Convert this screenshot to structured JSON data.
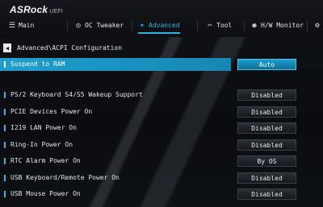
{
  "brand": {
    "name": "ASRock",
    "suffix": "UEFI"
  },
  "tabs": [
    {
      "label": "Main",
      "icon": "list-icon",
      "glyph": "☰"
    },
    {
      "label": "OC Tweaker",
      "icon": "gauge-icon",
      "glyph": "◎"
    },
    {
      "label": "Advanced",
      "icon": "star-icon",
      "glyph": "✶"
    },
    {
      "label": "Tool",
      "icon": "wrench-icon",
      "glyph": "✂"
    },
    {
      "label": "H/W Monitor",
      "icon": "monitor-icon",
      "glyph": "◉"
    },
    {
      "label": "",
      "icon": "gear-icon",
      "glyph": "⚙"
    }
  ],
  "active_tab": "Advanced",
  "breadcrumb": "Advanced\\ACPI Configuration",
  "settings": [
    {
      "label": "Suspend to RAM",
      "value": "Auto",
      "selected": true
    },
    {
      "label": "PS/2 Keyboard S4/S5 Wakeup Support",
      "value": "Disabled"
    },
    {
      "label": "PCIE Devices Power On",
      "value": "Disabled"
    },
    {
      "label": "I219 LAN Power On",
      "value": "Disabled"
    },
    {
      "label": "Ring-In Power On",
      "value": "Disabled"
    },
    {
      "label": "RTC Alarm Power On",
      "value": "By OS"
    },
    {
      "label": "USB Keyboard/Remote Power On",
      "value": "Disabled"
    },
    {
      "label": "USB Mouse Power On",
      "value": "Disabled"
    }
  ],
  "colors": {
    "accent": "#2fb4e8",
    "selection": "#1f9fce"
  }
}
